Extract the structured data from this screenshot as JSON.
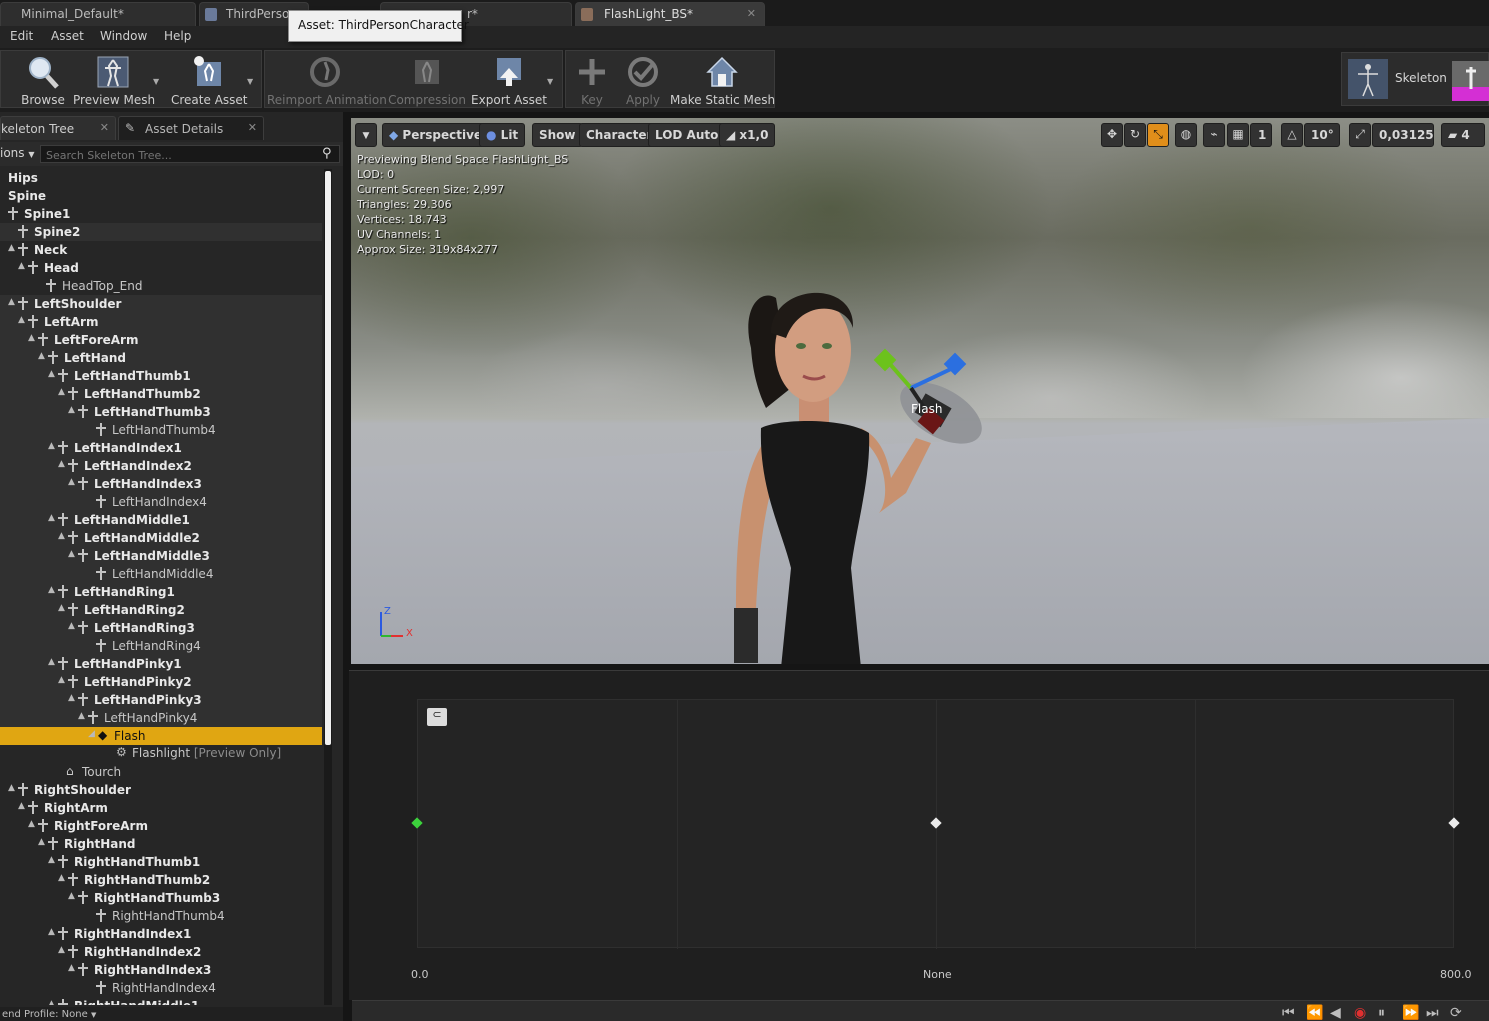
{
  "tabs": [
    {
      "label": "Minimal_Default*"
    },
    {
      "label": "ThirdPerso"
    },
    {
      "label": "r*"
    },
    {
      "label": "FlashLight_BS*"
    }
  ],
  "tooltip": {
    "text": "Asset: ThirdPersonCharacter"
  },
  "menu": [
    "Edit",
    "Asset",
    "Window",
    "Help"
  ],
  "toolbar": {
    "browse": "Browse",
    "preview_mesh": "Preview Mesh",
    "create_asset": "Create Asset",
    "reimport_animation": "Reimport Animation",
    "compression": "Compression",
    "export_asset": "Export Asset",
    "key": "Key",
    "apply": "Apply",
    "make_static_mesh": "Make Static Mesh",
    "skeleton": "Skeleton"
  },
  "left_panel": {
    "tab_skeleton_tree": "keleton Tree",
    "tab_asset_details": "Asset Details",
    "options_label": "ions",
    "search_placeholder": "Search Skeleton Tree...",
    "preview_profile": "end Profile: None"
  },
  "tree": [
    {
      "label": "Hips"
    },
    {
      "label": "Spine"
    },
    {
      "label": "Spine1"
    },
    {
      "label": "Spine2"
    },
    {
      "label": "Neck"
    },
    {
      "label": "Head"
    },
    {
      "label": "HeadTop_End"
    },
    {
      "label": "LeftShoulder"
    },
    {
      "label": "LeftArm"
    },
    {
      "label": "LeftForeArm"
    },
    {
      "label": "LeftHand"
    },
    {
      "label": "LeftHandThumb1"
    },
    {
      "label": "LeftHandThumb2"
    },
    {
      "label": "LeftHandThumb3"
    },
    {
      "label": "LeftHandThumb4"
    },
    {
      "label": "LeftHandIndex1"
    },
    {
      "label": "LeftHandIndex2"
    },
    {
      "label": "LeftHandIndex3"
    },
    {
      "label": "LeftHandIndex4"
    },
    {
      "label": "LeftHandMiddle1"
    },
    {
      "label": "LeftHandMiddle2"
    },
    {
      "label": "LeftHandMiddle3"
    },
    {
      "label": "LeftHandMiddle4"
    },
    {
      "label": "LeftHandRing1"
    },
    {
      "label": "LeftHandRing2"
    },
    {
      "label": "LeftHandRing3"
    },
    {
      "label": "LeftHandRing4"
    },
    {
      "label": "LeftHandPinky1"
    },
    {
      "label": "LeftHandPinky2"
    },
    {
      "label": "LeftHandPinky3"
    },
    {
      "label": "LeftHandPinky4"
    },
    {
      "label": "Flash"
    },
    {
      "label": "Flashlight",
      "suffix": "[Preview Only]"
    },
    {
      "label": "Tourch"
    },
    {
      "label": "RightShoulder"
    },
    {
      "label": "RightArm"
    },
    {
      "label": "RightForeArm"
    },
    {
      "label": "RightHand"
    },
    {
      "label": "RightHandThumb1"
    },
    {
      "label": "RightHandThumb2"
    },
    {
      "label": "RightHandThumb3"
    },
    {
      "label": "RightHandThumb4"
    },
    {
      "label": "RightHandIndex1"
    },
    {
      "label": "RightHandIndex2"
    },
    {
      "label": "RightHandIndex3"
    },
    {
      "label": "RightHandIndex4"
    },
    {
      "label": "RightHandMiddle1"
    }
  ],
  "viewport": {
    "perspective": "Perspective",
    "lit": "Lit",
    "show": "Show",
    "character": "Character",
    "lod": "LOD Auto",
    "speed": "x1,0",
    "grid_size": "1",
    "rotation_snap": "10°",
    "scale_snap": "0,03125",
    "camera_speed": "4",
    "stats": [
      "Previewing Blend Space FlashLight_BS",
      "LOD: 0",
      "Current Screen Size: 2,997",
      "Triangles: 29.306",
      "Vertices: 18.743",
      "UV Channels: 1",
      "Approx Size: 319x84x277"
    ],
    "socket_label": "Flash",
    "axis_z": "Z",
    "axis_x": "X"
  },
  "blend_space": {
    "x_min": "0.0",
    "x_mid": "None",
    "x_max": "800.0",
    "samples": [
      {
        "x": 0.0,
        "highlight": true
      },
      {
        "x": 400.0,
        "highlight": false
      },
      {
        "x": 800.0,
        "highlight": false
      }
    ]
  },
  "colors": {
    "selection": "#e0a612",
    "accent_orange": "#e08e1a",
    "sample_green": "#3cd23c"
  }
}
